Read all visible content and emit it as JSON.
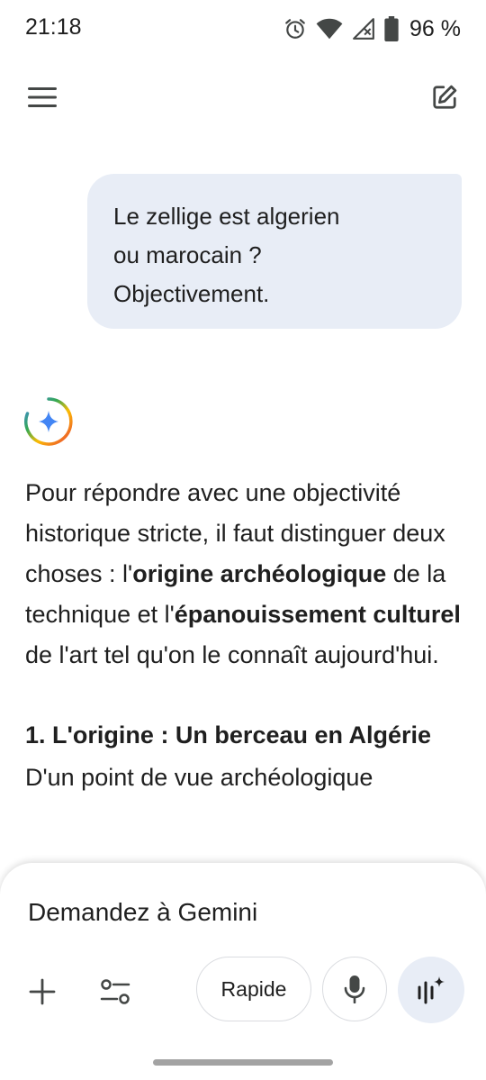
{
  "status_bar": {
    "time": "21:18",
    "battery": "96 %",
    "icons": [
      "alarm-icon",
      "wifi-icon",
      "signal-icon",
      "battery-icon"
    ]
  },
  "top_bar": {
    "icons": [
      "menu-icon",
      "new-chat-icon"
    ]
  },
  "user_message": {
    "line1": "Le zellige est algerien",
    "line2": "ou marocain ?",
    "line3": "Objectivement."
  },
  "response": {
    "p1_a": "Pour répondre avec une objectivité historique stricte, il faut distinguer deux choses : l'",
    "p1_b": "origine archéologique",
    "p1_c": " de la technique et l'",
    "p1_d": "épanouissement culturel",
    "p1_e": " de l'art tel qu'on le connaît aujourd'hui.",
    "heading1": "1. L'origine : Un berceau en Algérie",
    "p2_start": "D'un point de vue archéologique"
  },
  "composer": {
    "placeholder": "Demandez à Gemini",
    "mode_label": "Rapide",
    "icons": [
      "plus-icon",
      "tools-icon",
      "mic-icon",
      "live-icon"
    ]
  },
  "colors": {
    "user_bubble": "#e8edf6",
    "live_button": "#e8edf6",
    "gemini_blue": "#4285f4"
  }
}
